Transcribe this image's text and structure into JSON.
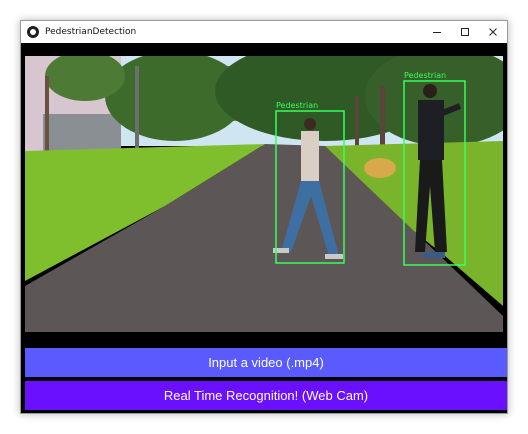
{
  "window": {
    "title": "PedestrianDetection",
    "controls": [
      "minimize-icon",
      "maximize-icon",
      "close-icon"
    ]
  },
  "video_frame": {
    "detections": [
      {
        "label": "Pedestrian"
      },
      {
        "label": "Pedestrian"
      }
    ]
  },
  "buttons": {
    "input_video_label": "Input a video (.mp4)",
    "webcam_label": "Real Time Recognition! (Web Cam)"
  },
  "colors": {
    "input_video_bg": "#5a5bff",
    "webcam_bg": "#6a10ff",
    "detection_box": "#36ff5c"
  }
}
